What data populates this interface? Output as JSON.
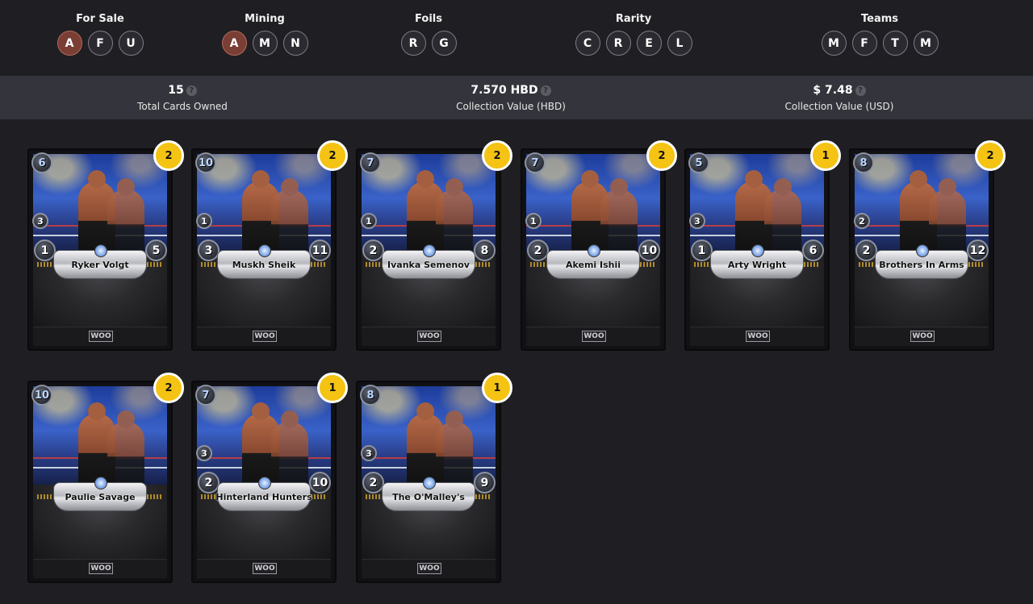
{
  "filters": [
    {
      "title": "For Sale",
      "buttons": [
        {
          "label": "A",
          "active": true
        },
        {
          "label": "F",
          "active": false
        },
        {
          "label": "U",
          "active": false
        }
      ]
    },
    {
      "title": "Mining",
      "buttons": [
        {
          "label": "A",
          "active": true
        },
        {
          "label": "M",
          "active": false
        },
        {
          "label": "N",
          "active": false
        }
      ]
    },
    {
      "title": "Foils",
      "buttons": [
        {
          "label": "R",
          "active": false
        },
        {
          "label": "G",
          "active": false
        }
      ]
    },
    {
      "title": "Rarity",
      "buttons": [
        {
          "label": "C",
          "active": false
        },
        {
          "label": "R",
          "active": false
        },
        {
          "label": "E",
          "active": false
        },
        {
          "label": "L",
          "active": false
        }
      ]
    },
    {
      "title": "Teams",
      "buttons": [
        {
          "label": "M",
          "active": false
        },
        {
          "label": "F",
          "active": false
        },
        {
          "label": "T",
          "active": false
        },
        {
          "label": "M",
          "active": false
        }
      ]
    }
  ],
  "stats": {
    "total_cards": {
      "value": "15",
      "label": "Total Cards Owned"
    },
    "value_hbd": {
      "value": "7.570 HBD",
      "label": "Collection Value (HBD)"
    },
    "value_usd": {
      "value": "$ 7.48",
      "label": "Collection Value (USD)"
    }
  },
  "cards": [
    {
      "name": "Ryker Volgt",
      "count": "2",
      "mana": "6",
      "speed": "3",
      "left": "1",
      "right": "5"
    },
    {
      "name": "Muskh Sheik",
      "count": "2",
      "mana": "10",
      "speed": "1",
      "left": "3",
      "right": "11"
    },
    {
      "name": "Ivanka Semenov",
      "count": "2",
      "mana": "7",
      "speed": "1",
      "left": "2",
      "right": "8"
    },
    {
      "name": "Akemi Ishii",
      "count": "2",
      "mana": "7",
      "speed": "1",
      "left": "2",
      "right": "10"
    },
    {
      "name": "Arty Wright",
      "count": "1",
      "mana": "5",
      "speed": "3",
      "left": "1",
      "right": "6"
    },
    {
      "name": "Brothers In Arms",
      "count": "2",
      "mana": "8",
      "speed": "2",
      "left": "2",
      "right": "12"
    },
    {
      "name": "Paulie Savage",
      "count": "2",
      "mana": "10",
      "speed": "",
      "left": "",
      "right": ""
    },
    {
      "name": "Hinterland Hunters",
      "count": "1",
      "mana": "7",
      "speed": "3",
      "left": "2",
      "right": "10"
    },
    {
      "name": "The O'Malley's",
      "count": "1",
      "mana": "8",
      "speed": "3",
      "left": "2",
      "right": "9"
    }
  ],
  "card_footer_logo": "WOO",
  "help_icon": "?",
  "colors": {
    "background": "#1f1f23",
    "stats_bar": "#34353c",
    "active_filter": "#7a3e34",
    "count_badge": "#f4c313"
  }
}
